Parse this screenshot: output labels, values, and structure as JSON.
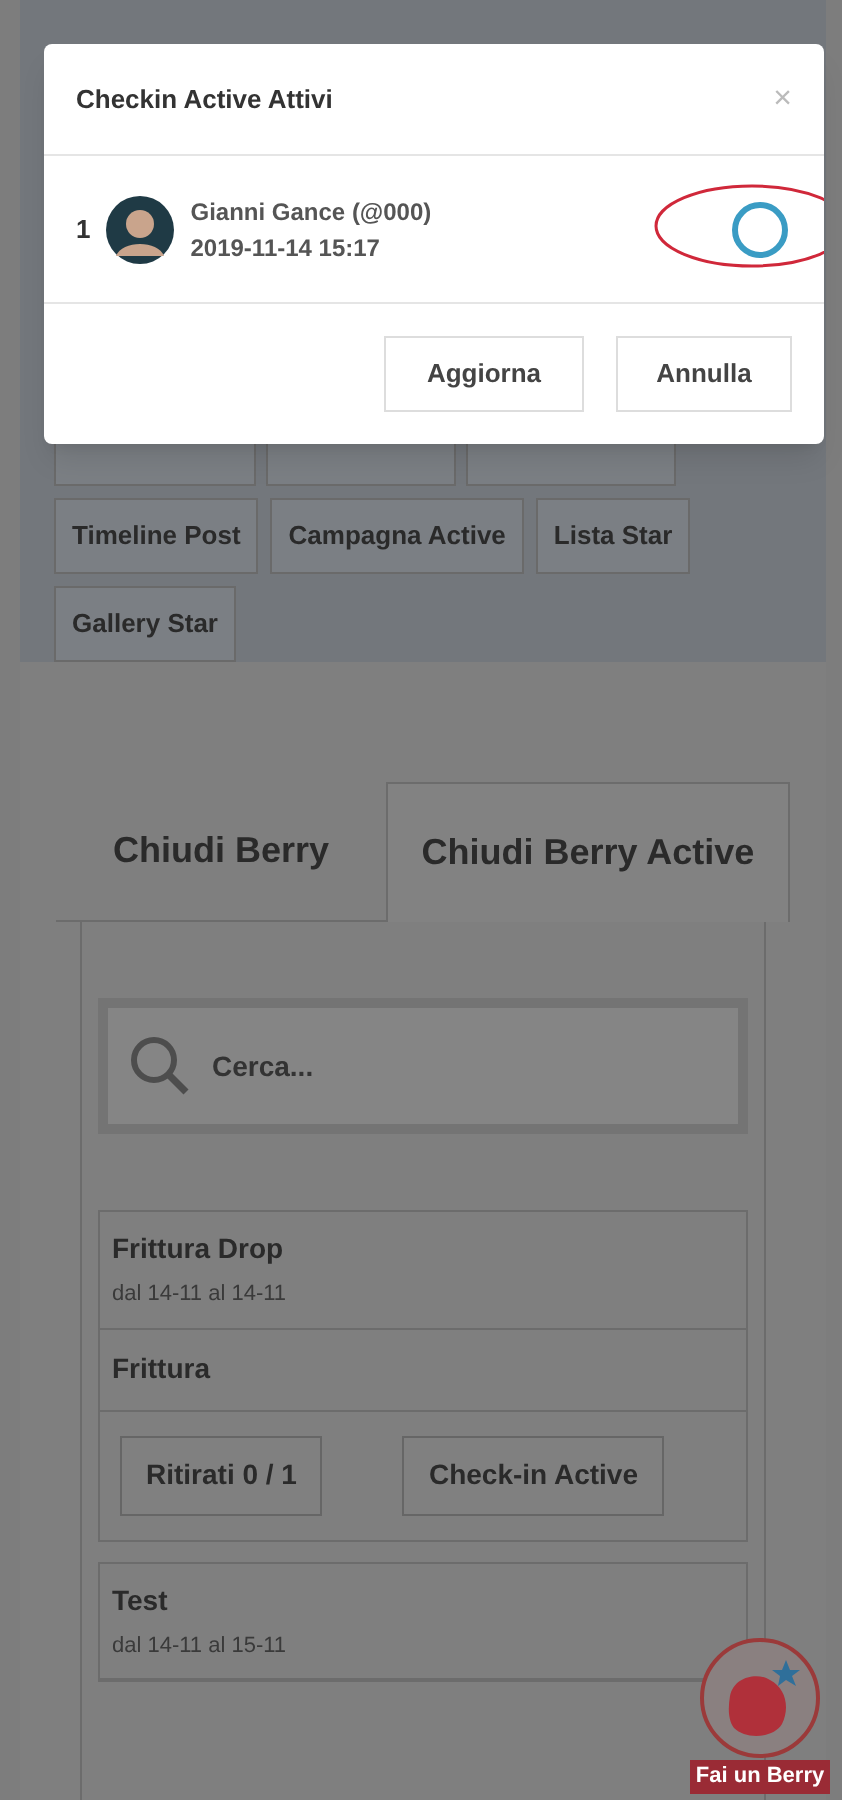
{
  "modal": {
    "title": "Checkin Active Attivi",
    "close": "×",
    "checkins": [
      {
        "index": "1",
        "name": "Gianni Gance",
        "handle": "(@000)",
        "time": "2019-11-14 15:17",
        "selected": false
      }
    ],
    "buttons": [
      "Aggiorna",
      "Annulla"
    ]
  },
  "menu_buttons": [
    "Timeline Post",
    "Campagna Active",
    "Lista Star",
    "Gallery Star"
  ],
  "tabs": [
    {
      "label": "Chiudi Berry",
      "selected": false
    },
    {
      "label": "Chiudi Berry Active",
      "selected": true
    }
  ],
  "search": {
    "placeholder": "Cerca..."
  },
  "events": [
    {
      "title": "Frittura Drop",
      "dates": "dal 14-11 al 14-11",
      "product": "Frittura",
      "buttons": [
        "Ritirati 0 / 1",
        "Check-in Active"
      ]
    },
    {
      "title": "Test",
      "dates": "dal 14-11 al 15-11"
    }
  ],
  "fab": {
    "label": "Fai un Berry"
  }
}
